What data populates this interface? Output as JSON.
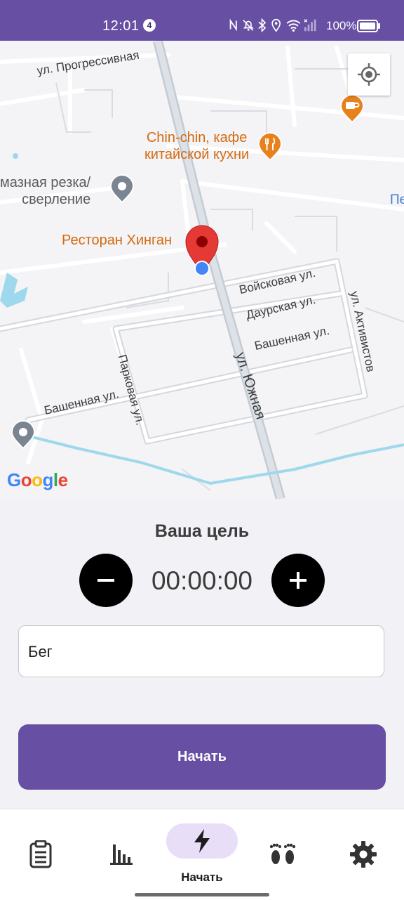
{
  "status_bar": {
    "time": "12:01",
    "notification_count": "4",
    "battery": "100%"
  },
  "map": {
    "streets": {
      "progressivnaya": "ул. Прогрессивная",
      "voiskovaya": "Войсковая ул.",
      "daurskaya": "Даурская ул.",
      "bashennaya_right": "Башенная ул.",
      "bashennaya_left": "Башенная ул.",
      "parkovaya": "Парковая ул.",
      "yuzhnaya": "ул. Южная",
      "aktivistov": "ул. Активистов"
    },
    "pois": {
      "cafe": "Chin-chin, кафе\nкитайской кухни",
      "restaurant": "Ресторан Хинган",
      "cutting": "мазная резка/\nсверление",
      "edge_pe": "Пе"
    },
    "google_logo": "Google"
  },
  "goal": {
    "title": "Ваша цель",
    "time": "00:00:00"
  },
  "activity": {
    "value": "Бег"
  },
  "start_button": {
    "label": "Начать"
  },
  "bottom_nav": {
    "active_label": "Начать",
    "items": [
      "clipboard-icon",
      "bar-chart-icon",
      "bolt-icon",
      "footprints-icon",
      "gear-icon"
    ]
  },
  "colors": {
    "primary": "#6750A4",
    "pill": "#E8DEF8",
    "poi_orange": "#E8801C",
    "marker_red": "#E53935",
    "user_dot": "#4285F4"
  }
}
